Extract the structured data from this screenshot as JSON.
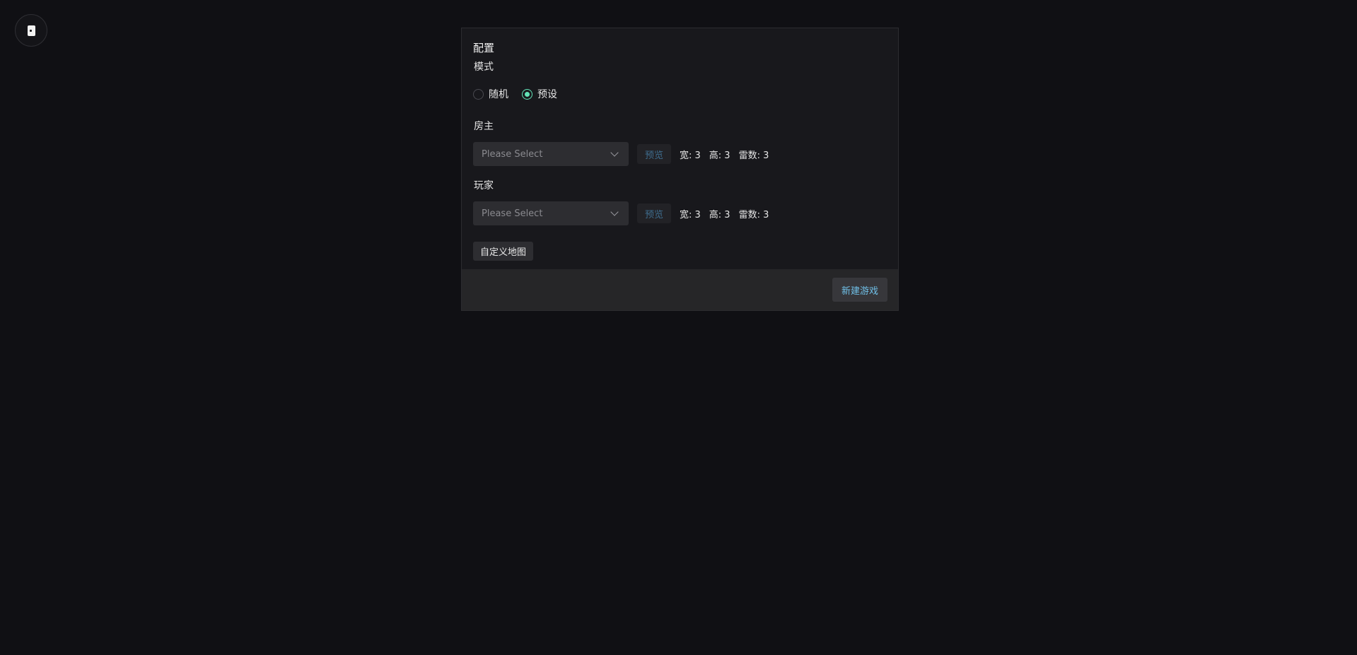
{
  "top_button": {
    "icon": "card-icon"
  },
  "config": {
    "title": "配置",
    "mode": {
      "label": "模式",
      "options": [
        {
          "label": "随机",
          "checked": false
        },
        {
          "label": "预设",
          "checked": true
        }
      ]
    },
    "host": {
      "label": "房主",
      "select_placeholder": "Please Select",
      "preview_label": "预览",
      "width_text": "宽: 3",
      "height_text": "高: 3",
      "mines_text": "雷数: 3"
    },
    "player": {
      "label": "玩家",
      "select_placeholder": "Please Select",
      "preview_label": "预览",
      "width_text": "宽: 3",
      "height_text": "高: 3",
      "mines_text": "雷数: 3"
    },
    "custom_map_label": "自定义地图",
    "new_game_label": "新建游戏"
  },
  "colors": {
    "background": "#101014",
    "card": "#18181c",
    "footer": "#262628",
    "accent_green": "#63e2b7",
    "accent_blue": "#70c0e8"
  }
}
